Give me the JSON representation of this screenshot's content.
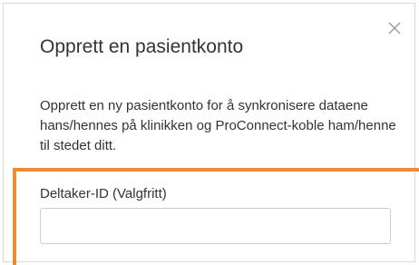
{
  "dialog": {
    "title": "Opprett en pasientkonto",
    "description": "Opprett en ny pasientkonto for å synkronisere dataene hans/hennes på klinikken og ProConnect-koble ham/henne til stedet ditt.",
    "close_icon": "close-icon"
  },
  "form": {
    "participant_id_label": "Deltaker-ID (Valgfritt)",
    "participant_id_value": "",
    "participant_id_placeholder": ""
  },
  "colors": {
    "highlight": "#f28a30",
    "text": "#333333",
    "border": "#d8d8d8"
  }
}
